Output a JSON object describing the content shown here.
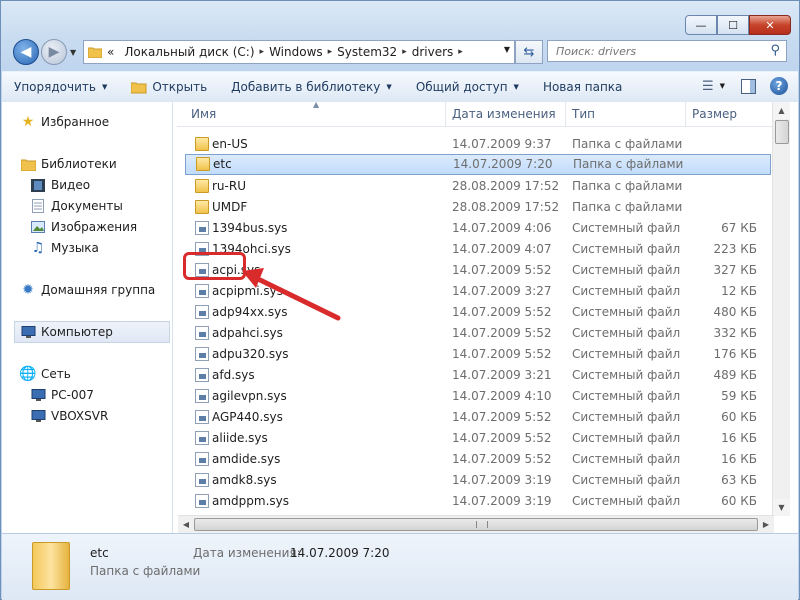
{
  "titlebar": {
    "min": "—",
    "max": "☐",
    "close": "✕"
  },
  "address": {
    "overflow": "«",
    "crumbs": [
      "Локальный диск (C:)",
      "Windows",
      "System32",
      "drivers"
    ]
  },
  "search": {
    "placeholder": "Поиск: drivers"
  },
  "toolbar": {
    "organize": "Упорядочить",
    "open": "Открыть",
    "add_to_library": "Добавить в библиотеку",
    "share": "Общий доступ",
    "new_folder": "Новая папка"
  },
  "nav_pane": {
    "favorites": "Избранное",
    "libraries": "Библиотеки",
    "library_items": [
      "Видео",
      "Документы",
      "Изображения",
      "Музыка"
    ],
    "homegroup": "Домашняя группа",
    "computer": "Компьютер",
    "network": "Сеть",
    "network_items": [
      "PC-007",
      "VBOXSVR"
    ]
  },
  "columns": {
    "name": "Имя",
    "date": "Дата изменения",
    "type": "Тип",
    "size": "Размер"
  },
  "files": [
    {
      "name": "en-US",
      "date": "14.07.2009 9:37",
      "type": "Папка с файлами",
      "size": "",
      "kind": "folder"
    },
    {
      "name": "etc",
      "date": "14.07.2009 7:20",
      "type": "Папка с файлами",
      "size": "",
      "kind": "folder",
      "selected": true
    },
    {
      "name": "ru-RU",
      "date": "28.08.2009 17:52",
      "type": "Папка с файлами",
      "size": "",
      "kind": "folder"
    },
    {
      "name": "UMDF",
      "date": "28.08.2009 17:52",
      "type": "Папка с файлами",
      "size": "",
      "kind": "folder"
    },
    {
      "name": "1394bus.sys",
      "date": "14.07.2009 4:06",
      "type": "Системный файл",
      "size": "67 КБ",
      "kind": "sys"
    },
    {
      "name": "1394ohci.sys",
      "date": "14.07.2009 4:07",
      "type": "Системный файл",
      "size": "223 КБ",
      "kind": "sys"
    },
    {
      "name": "acpi.sys",
      "date": "14.07.2009 5:52",
      "type": "Системный файл",
      "size": "327 КБ",
      "kind": "sys"
    },
    {
      "name": "acpipmi.sys",
      "date": "14.07.2009 3:27",
      "type": "Системный файл",
      "size": "12 КБ",
      "kind": "sys"
    },
    {
      "name": "adp94xx.sys",
      "date": "14.07.2009 5:52",
      "type": "Системный файл",
      "size": "480 КБ",
      "kind": "sys"
    },
    {
      "name": "adpahci.sys",
      "date": "14.07.2009 5:52",
      "type": "Системный файл",
      "size": "332 КБ",
      "kind": "sys"
    },
    {
      "name": "adpu320.sys",
      "date": "14.07.2009 5:52",
      "type": "Системный файл",
      "size": "176 КБ",
      "kind": "sys"
    },
    {
      "name": "afd.sys",
      "date": "14.07.2009 3:21",
      "type": "Системный файл",
      "size": "489 КБ",
      "kind": "sys"
    },
    {
      "name": "agilevpn.sys",
      "date": "14.07.2009 4:10",
      "type": "Системный файл",
      "size": "59 КБ",
      "kind": "sys"
    },
    {
      "name": "AGP440.sys",
      "date": "14.07.2009 5:52",
      "type": "Системный файл",
      "size": "60 КБ",
      "kind": "sys"
    },
    {
      "name": "aliide.sys",
      "date": "14.07.2009 5:52",
      "type": "Системный файл",
      "size": "16 КБ",
      "kind": "sys"
    },
    {
      "name": "amdide.sys",
      "date": "14.07.2009 5:52",
      "type": "Системный файл",
      "size": "16 КБ",
      "kind": "sys"
    },
    {
      "name": "amdk8.sys",
      "date": "14.07.2009 3:19",
      "type": "Системный файл",
      "size": "63 КБ",
      "kind": "sys"
    },
    {
      "name": "amdppm.sys",
      "date": "14.07.2009 3:19",
      "type": "Системный файл",
      "size": "60 КБ",
      "kind": "sys"
    }
  ],
  "details": {
    "name": "etc",
    "type": "Папка с файлами",
    "modified_label": "Дата изменения:",
    "modified_value": "14.07.2009 7:20"
  },
  "colors": {
    "highlight": "#d92b2b",
    "selection": "#c1dcfc"
  }
}
